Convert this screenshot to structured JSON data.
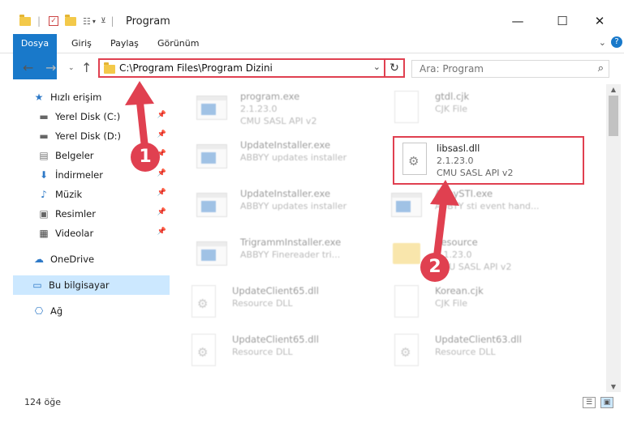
{
  "window": {
    "title": "Program",
    "minimize_glyph": "—",
    "maximize_glyph": "☐",
    "close_glyph": "✕"
  },
  "ribbon": {
    "tabs": [
      "Dosya",
      "Giriş",
      "Paylaş",
      "Görünüm"
    ],
    "expand_glyph": "⌄",
    "help_glyph": "?"
  },
  "address": {
    "path": "C:\\Program Files\\Program Dizini",
    "dropdown_glyph": "⌄",
    "refresh_glyph": "↻"
  },
  "search": {
    "placeholder": "Ara: Program",
    "icon": "search-icon"
  },
  "nav": {
    "items": [
      {
        "label": "Hızlı erişim",
        "icon": "star-icon",
        "pinned": false
      },
      {
        "label": "Yerel Disk (C:)",
        "icon": "drive-icon",
        "pinned": true
      },
      {
        "label": "Yerel Disk (D:)",
        "icon": "drive-icon",
        "pinned": true
      },
      {
        "label": "Belgeler",
        "icon": "documents-icon",
        "pinned": true
      },
      {
        "label": "İndirmeler",
        "icon": "downloads-icon",
        "pinned": true
      },
      {
        "label": "Müzik",
        "icon": "music-icon",
        "pinned": true
      },
      {
        "label": "Resimler",
        "icon": "pictures-icon",
        "pinned": true
      },
      {
        "label": "Videolar",
        "icon": "videos-icon",
        "pinned": true
      },
      {
        "label": "OneDrive",
        "icon": "cloud-icon",
        "pinned": false
      },
      {
        "label": "Bu bilgisayar",
        "icon": "computer-icon",
        "pinned": false,
        "selected": true
      },
      {
        "label": "Ağ",
        "icon": "network-icon",
        "pinned": false
      }
    ]
  },
  "files": [
    {
      "name": "program.exe",
      "line2": "2.1.23.0",
      "line3": "CMU SASL API v2",
      "kind": "exe",
      "faded": true
    },
    {
      "name": "gtdl.cjk",
      "line2": "CJK File",
      "line3": "",
      "kind": "doc",
      "faded": true
    },
    {
      "name": "UpdateInstaller.exe",
      "line2": "ABBYY updates installer",
      "line3": "",
      "kind": "exe",
      "faded": true
    },
    {
      "name": "libsasl.dll",
      "line2": "2.1.23.0",
      "line3": "CMU SASL API v2",
      "kind": "dll",
      "faded": false
    },
    {
      "name": "UpdateInstaller.exe",
      "line2": "ABBYY updates installer",
      "line3": "",
      "kind": "exe",
      "faded": true
    },
    {
      "name": "AbbySTI.exe",
      "line2": "ABBYY sti event hand...",
      "line3": "",
      "kind": "exe",
      "faded": true
    },
    {
      "name": "TrigrammInstaller.exe",
      "line2": "ABBYY Finereader tri...",
      "line3": "",
      "kind": "exe",
      "faded": true
    },
    {
      "name": "Resource",
      "line2": "2.1.23.0",
      "line3": "CMU SASL API v2",
      "kind": "folder",
      "faded": true
    },
    {
      "name": "UpdateClient65.dll",
      "line2": "Resource DLL",
      "line3": "",
      "kind": "dll",
      "faded": true
    },
    {
      "name": "Korean.cjk",
      "line2": "CJK File",
      "line3": "",
      "kind": "doc",
      "faded": true
    },
    {
      "name": "UpdateClient65.dll",
      "line2": "Resource DLL",
      "line3": "",
      "kind": "dll",
      "faded": true
    },
    {
      "name": "UpdateClient63.dll",
      "line2": "Resource DLL",
      "line3": "",
      "kind": "dll",
      "faded": true
    }
  ],
  "status": {
    "count": "124 öğe"
  },
  "callouts": [
    "1",
    "2"
  ],
  "colors": {
    "accent": "#1979ca",
    "highlight": "#e04050",
    "selected_nav": "#cce8ff"
  }
}
